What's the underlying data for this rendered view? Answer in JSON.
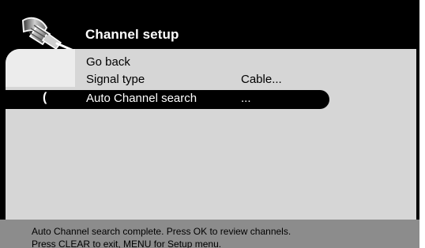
{
  "screen": {
    "title": "Channel setup",
    "icon": "cable-connector-icon"
  },
  "menu": {
    "items": [
      {
        "label": "Go back",
        "value": ""
      },
      {
        "label": "Signal type",
        "value": "Cable..."
      },
      {
        "label": "Auto Channel search",
        "value": "...",
        "selected": true
      }
    ],
    "selection_marker": "("
  },
  "status": {
    "line1": "Auto Channel search complete. Press OK to review channels.",
    "line2": "Press CLEAR to exit, MENU for Setup menu."
  },
  "colors": {
    "background": "#000000",
    "panel": "#d6d6d6",
    "panel_highlight": "#ececec",
    "selection_bar": "#000000",
    "status_bar": "#8c8c8c",
    "title_text": "#ffffff"
  }
}
